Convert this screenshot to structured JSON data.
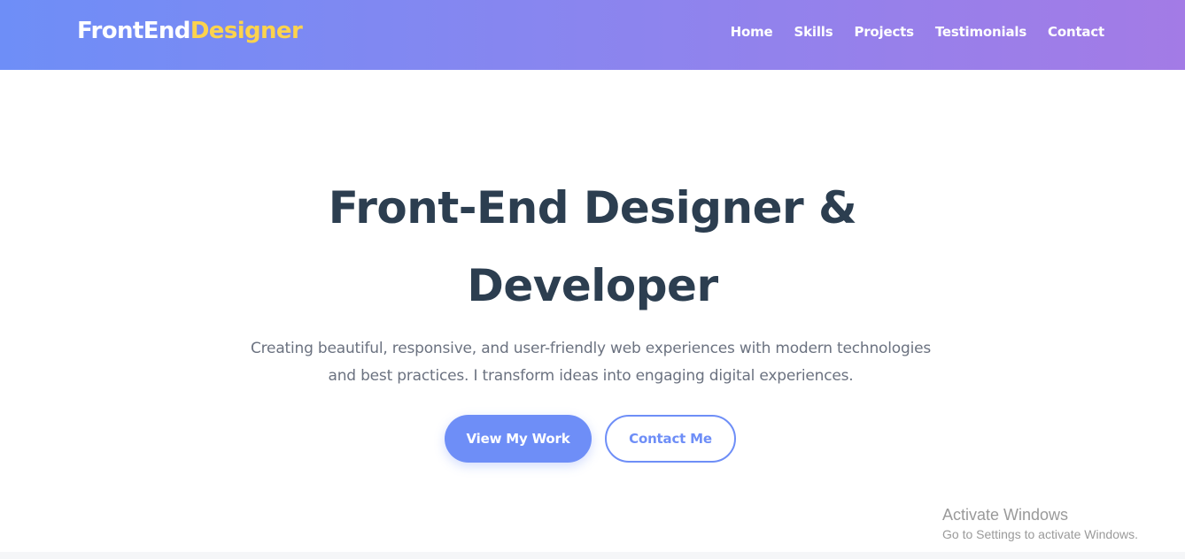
{
  "header": {
    "logo_main": "FrontEnd",
    "logo_accent": "Designer",
    "nav": [
      {
        "label": "Home"
      },
      {
        "label": "Skills"
      },
      {
        "label": "Projects"
      },
      {
        "label": "Testimonials"
      },
      {
        "label": "Contact"
      }
    ]
  },
  "hero": {
    "title": "Front-End Designer & Developer",
    "subtitle": "Creating beautiful, responsive, and user-friendly web experiences with modern technologies and best practices. I transform ideas into engaging digital experiences.",
    "primary_button": "View My Work",
    "secondary_button": "Contact Me"
  },
  "watermark": {
    "title": "Activate Windows",
    "subtitle": "Go to Settings to activate Windows."
  },
  "colors": {
    "gradient_start": "#6e8ef7",
    "gradient_end": "#a37be6",
    "logo_accent": "#fcd34d",
    "heading": "#2c3e50",
    "body_text": "#6b7280",
    "primary": "#6e8ef7"
  }
}
